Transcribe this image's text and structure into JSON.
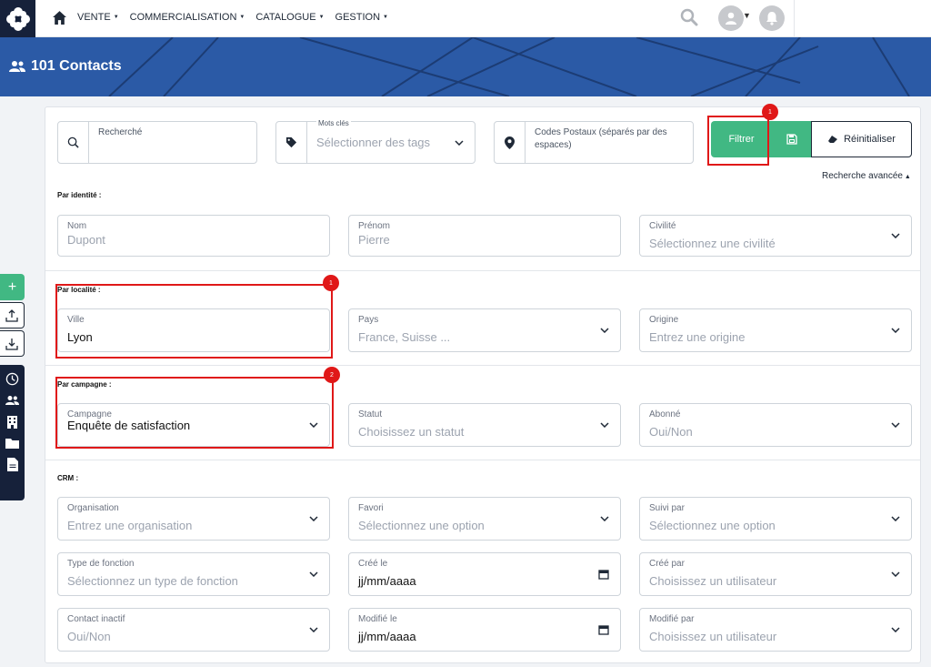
{
  "nav": {
    "items": [
      "VENTE",
      "COMMERCIALISATION",
      "CATALOGUE",
      "GESTION"
    ],
    "home_icon": "home-icon",
    "search_icon": "search-icon",
    "avatar_icon": "user-icon",
    "bell_icon": "bell-icon"
  },
  "header": {
    "title": "101 Contacts",
    "icon": "users-icon"
  },
  "search": {
    "recherche_label": "Recherché",
    "tags_label": "Mots clés",
    "tags_placeholder": "Sélectionner des tags",
    "postal_placeholder": "Codes Postaux (séparés par des espaces)"
  },
  "actions": {
    "filter_label": "Filtrer",
    "reset_label": "Réinitialiser",
    "advanced_label": "Recherche avancée",
    "save_icon": "save-icon",
    "eraser_icon": "eraser-icon"
  },
  "sections": {
    "identity": "Par identité :",
    "locality": "Par localité :",
    "campaign": "Par campagne :",
    "crm": "CRM :"
  },
  "fields": {
    "nom": {
      "label": "Nom",
      "value": "Dupont"
    },
    "prenom": {
      "label": "Prénom",
      "value": "Pierre"
    },
    "civilite": {
      "label": "Civilité",
      "value": "Sélectionnez une civilité"
    },
    "ville": {
      "label": "Ville",
      "value": "Lyon"
    },
    "pays": {
      "label": "Pays",
      "value": "France, Suisse ..."
    },
    "origine": {
      "label": "Origine",
      "value": "Entrez une origine"
    },
    "campagne": {
      "label": "Campagne",
      "value": "Enquête de satisfaction"
    },
    "statut": {
      "label": "Statut",
      "value": "Choisissez un statut"
    },
    "abonne": {
      "label": "Abonné",
      "value": "Oui/Non"
    },
    "organisation": {
      "label": "Organisation",
      "value": "Entrez une organisation"
    },
    "favori": {
      "label": "Favori",
      "value": "Sélectionnez une option"
    },
    "suivi_par": {
      "label": "Suivi par",
      "value": "Sélectionnez une option"
    },
    "type_fonction": {
      "label": "Type de fonction",
      "value": "Sélectionnez un type de fonction"
    },
    "cree_le": {
      "label": "Créé le",
      "value": "jj/mm/aaaa"
    },
    "cree_par": {
      "label": "Créé par",
      "value": "Choisissez un utilisateur"
    },
    "contact_inactif": {
      "label": "Contact inactif",
      "value": "Oui/Non"
    },
    "modifie_le": {
      "label": "Modifié le",
      "value": "jj/mm/aaaa"
    },
    "modifie_par": {
      "label": "Modifié par",
      "value": "Choisissez un utilisateur"
    }
  },
  "annotations": [
    "1",
    "1",
    "2"
  ],
  "colors": {
    "accent": "#41b883",
    "banner": "#2b5aa6",
    "dark": "#16213a",
    "highlight": "#e01818"
  }
}
